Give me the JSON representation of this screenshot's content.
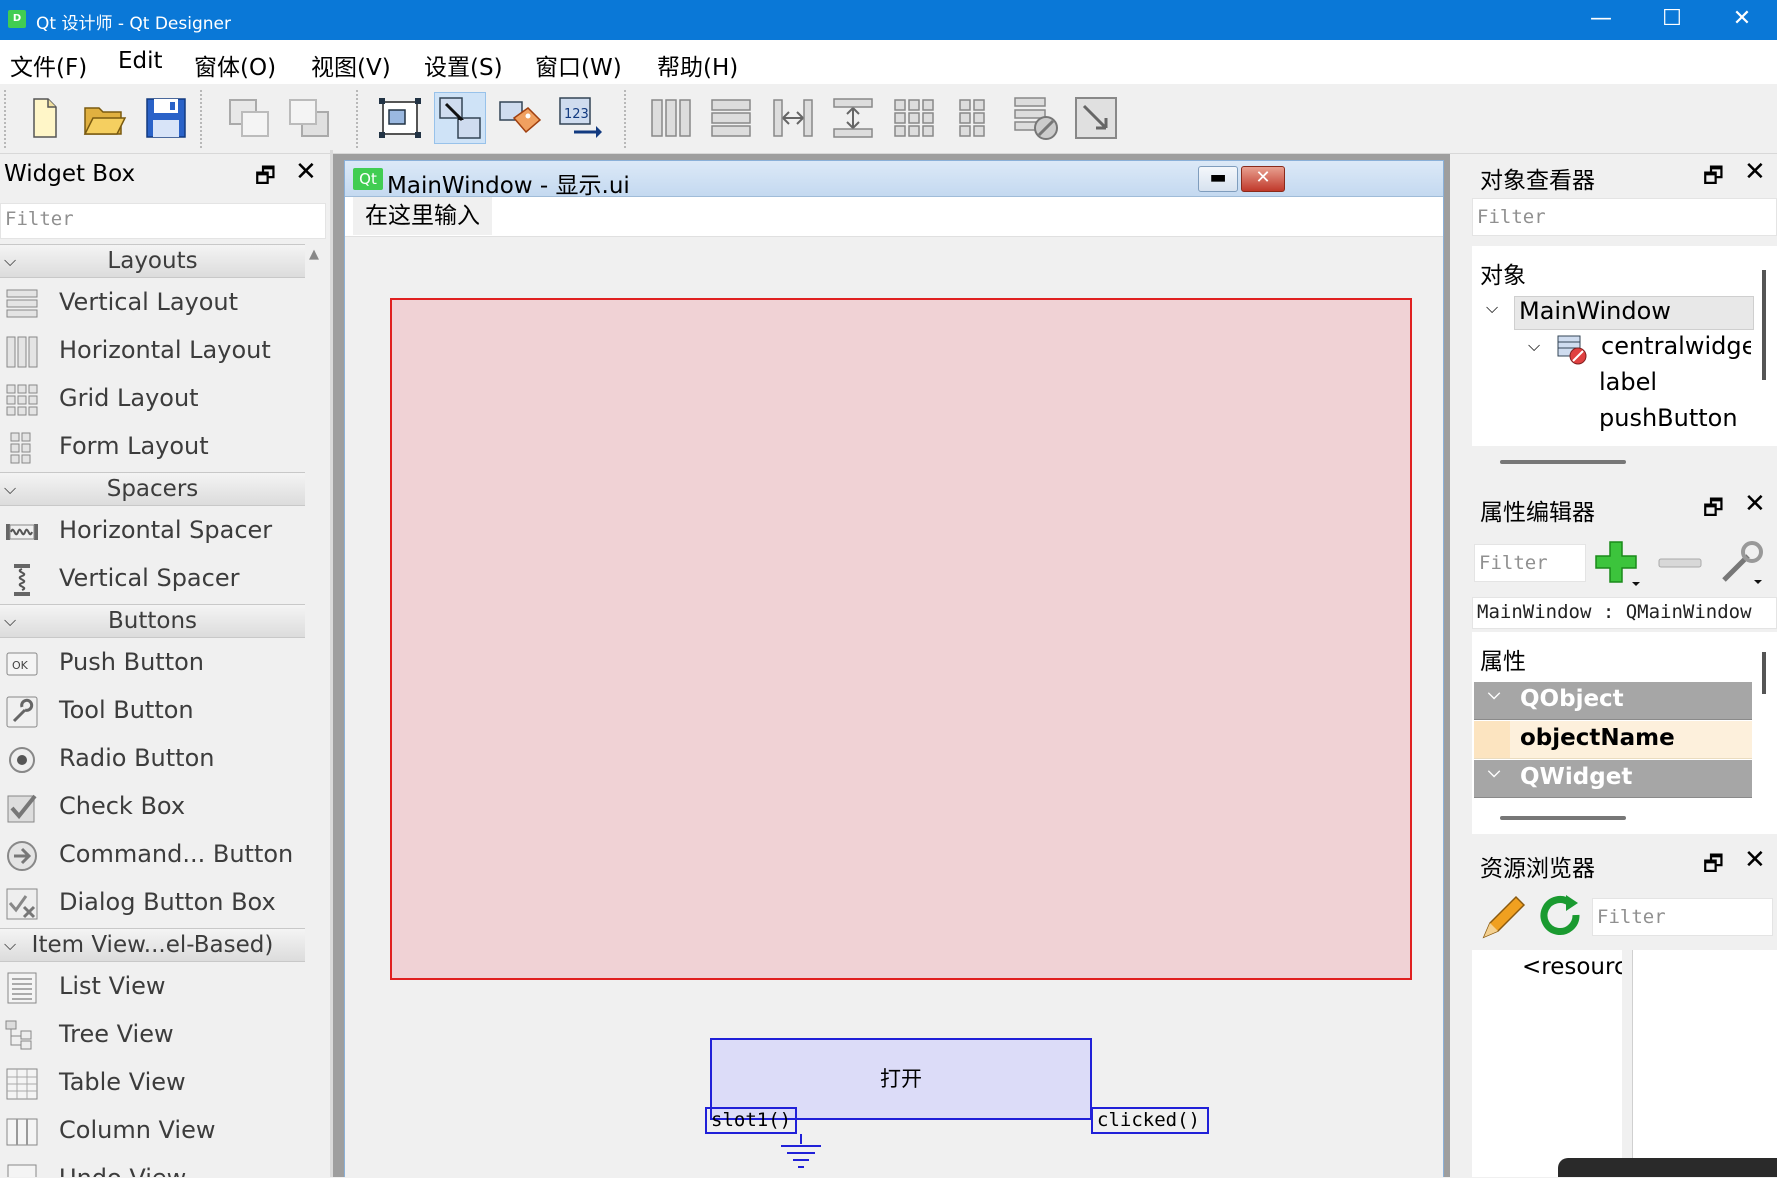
{
  "window": {
    "title": "Qt 设计师 - Qt Designer",
    "minimize": "—",
    "maximize": "☐",
    "close": "✕"
  },
  "menubar": [
    "文件(F)",
    "Edit",
    "窗体(O)",
    "视图(V)",
    "设置(S)",
    "窗口(W)",
    "帮助(H)"
  ],
  "toolbar": {
    "groups": [
      [
        "new-form-icon",
        "open-form-icon",
        "save-form-icon"
      ],
      [
        "send-to-back-icon",
        "bring-to-front-icon"
      ],
      [
        "edit-widgets-icon",
        "edit-signals-slots-icon",
        "edit-buddies-icon",
        "edit-tab-order-icon"
      ],
      [
        "lay-out-horizontally-icon",
        "lay-out-vertically-icon",
        "lay-out-horizontal-splitter-icon",
        "lay-out-vertical-splitter-icon",
        "lay-out-grid-icon",
        "lay-out-form-icon",
        "break-layout-icon",
        "adjust-size-icon"
      ]
    ]
  },
  "widget_box": {
    "title": "Widget Box",
    "float": "🗗",
    "close": "✕",
    "filter_placeholder": "Filter",
    "categories": [
      {
        "label": "Layouts",
        "items": [
          "Vertical Layout",
          "Horizontal Layout",
          "Grid Layout",
          "Form Layout"
        ]
      },
      {
        "label": "Spacers",
        "items": [
          "Horizontal Spacer",
          "Vertical Spacer"
        ]
      },
      {
        "label": "Buttons",
        "items": [
          "Push Button",
          "Tool Button",
          "Radio Button",
          "Check Box",
          "Command... Button",
          "Dialog Button Box"
        ]
      },
      {
        "label": "Item View...el-Based)",
        "items": [
          "List View",
          "Tree View",
          "Table View",
          "Column View",
          "Undo View"
        ]
      }
    ]
  },
  "form": {
    "title": "MainWindow - 显示.ui",
    "qt_badge": "Qt",
    "menu_placeholder": "在这里输入",
    "push_button_text": "打开",
    "slot_label": "slot1()",
    "signal_label": "clicked()"
  },
  "object_inspector": {
    "title": "对象查看器",
    "filter_placeholder": "Filter",
    "column_header": "对象",
    "tree": {
      "root": "MainWindow",
      "child": "centralwidge",
      "leaves": [
        "label",
        "pushButton"
      ]
    }
  },
  "property_editor": {
    "title": "属性编辑器",
    "filter_placeholder": "Filter",
    "class_line": "MainWindow : QMainWindow",
    "column_header": "属性",
    "rows": [
      {
        "label": "QObject",
        "kind": "group"
      },
      {
        "label": "objectName",
        "kind": "property"
      },
      {
        "label": "QWidget",
        "kind": "group"
      }
    ]
  },
  "resource_browser": {
    "title": "资源浏览器",
    "filter_placeholder": "Filter",
    "root_item": "<resourc"
  },
  "colors": {
    "titlebar": "#0a78d7",
    "label_fill": "#f0d2d5",
    "label_border": "#e02020",
    "connection_blue": "#2020d8",
    "group_row": "#a6a6a6",
    "property_highlight": "#fdf0dc"
  }
}
